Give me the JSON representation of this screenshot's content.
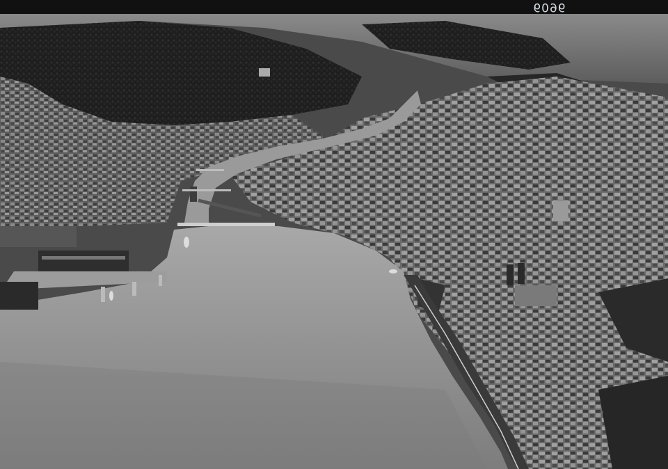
{
  "photo": {
    "plate_number": "6096",
    "colors": {
      "lake": "#8e8e8e",
      "forest": "#1f1f1f",
      "city": "#6b6b6b",
      "film_border": "#111111"
    }
  }
}
